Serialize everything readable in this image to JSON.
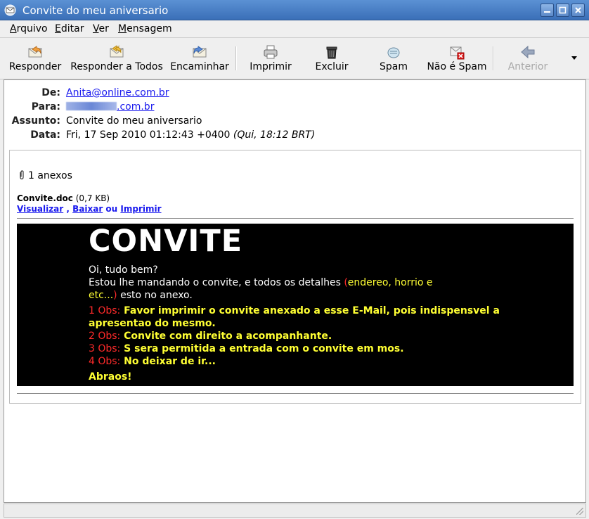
{
  "window": {
    "title": "Convite do meu aniversario"
  },
  "menu": {
    "items": [
      {
        "first": "A",
        "rest": "rquivo"
      },
      {
        "first": "E",
        "rest": "ditar"
      },
      {
        "first": "V",
        "rest": "er"
      },
      {
        "first": "M",
        "rest": "ensagem"
      }
    ]
  },
  "toolbar": {
    "reply": "Responder",
    "reply_all": "Responder a Todos",
    "forward": "Encaminhar",
    "print": "Imprimir",
    "delete": "Excluir",
    "spam": "Spam",
    "not_spam": "Não é Spam",
    "previous": "Anterior"
  },
  "header": {
    "from_label": "De:",
    "from_value": "Anita@online.com.br",
    "to_label": "Para:",
    "to_suffix": ".com.br",
    "subject_label": "Assunto:",
    "subject_value": "Convite do meu aniversario",
    "date_label": "Data:",
    "date_value": "Fri, 17 Sep 2010 01:12:43 +0400",
    "date_local": "(Qui, 18:12 BRT)"
  },
  "attachment": {
    "count_label": "1 anexos",
    "filename": "Convite.doc",
    "size": "(0,7 KB)",
    "view": "Visualizar",
    "sep1": " , ",
    "download": "Baixar",
    "or": " ou ",
    "print": "Imprimir"
  },
  "invite": {
    "title": "CONVITE",
    "greeting": "Oi, tudo bem?",
    "line2_a": "Estou lhe mandando o convite, e todos os detalhes ",
    "line2_b": "(",
    "line2_c": "endereo, horrio e",
    "line3_a": "etc...",
    "line3_b": ")",
    "line3_c": " esto no anexo.",
    "obs1_label": "1 Obs:",
    "obs1_text": " Favor imprimir o convite anexado a esse E-Mail, pois indispensvel a",
    "obs1_text2": "apresentao do mesmo.",
    "obs2_label": "2 Obs:",
    "obs2_text": " Convite com direito a acompanhante.",
    "obs3_label": "3 Obs:",
    "obs3_text": " S sera permitida a entrada com o convite em mos.",
    "obs4_label": "4 Obs:",
    "obs4_text": " No deixar de ir...",
    "closing": "Abraos!"
  },
  "colors": {
    "titlebar": "#4a80c6",
    "invite_bg": "#000000",
    "invite_yellow": "#ffff33",
    "invite_red": "#ff2a2a",
    "link": "#1a1aee"
  }
}
